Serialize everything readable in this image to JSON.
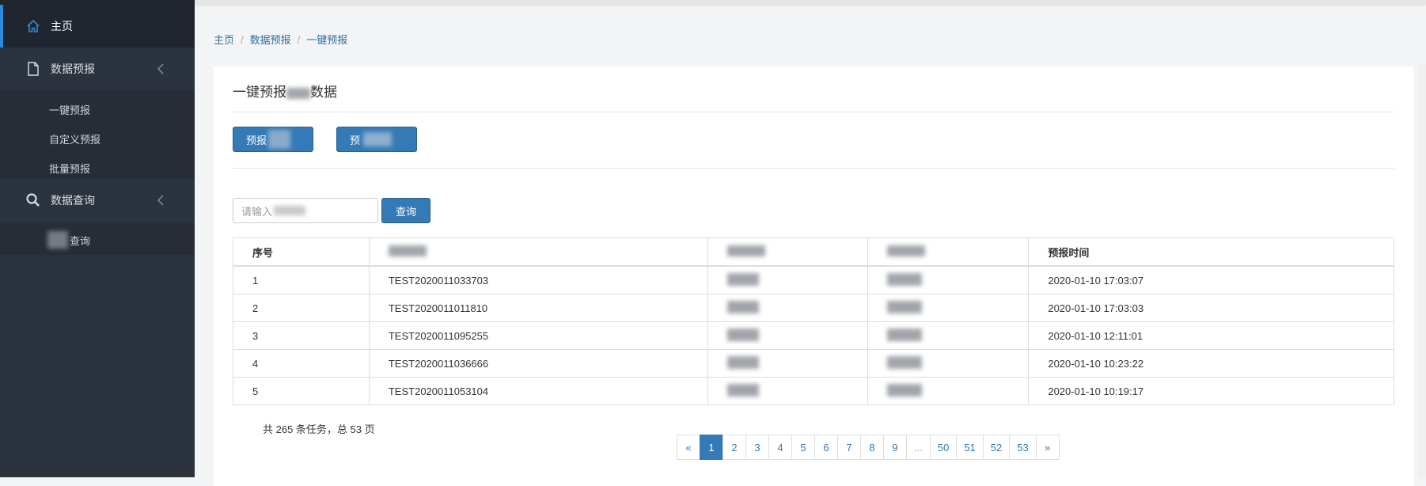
{
  "sidebar": {
    "home": "主页",
    "data_forecast": "数据预报",
    "sub_forecast": [
      "一键预报",
      "自定义预报",
      "批量预报"
    ],
    "data_query": "数据查询",
    "sub_query": "查询"
  },
  "breadcrumb": [
    "主页",
    "数据预报",
    "一键预报"
  ],
  "panel": {
    "title_prefix": "一键预报",
    "title_suffix": "数据",
    "btn1": "预报",
    "btn2": "预",
    "search_placeholder": "请输入",
    "query_button": "查询"
  },
  "table": {
    "headers": [
      "序号",
      "",
      "",
      "",
      "预报时间"
    ],
    "rows": [
      [
        "1",
        "TEST2020011033703",
        "",
        "",
        "2020-01-10 17:03:07"
      ],
      [
        "2",
        "TEST2020011011810",
        "",
        "",
        "2020-01-10 17:03:03"
      ],
      [
        "3",
        "TEST2020011095255",
        "",
        "",
        "2020-01-10 12:11:01"
      ],
      [
        "4",
        "TEST2020011036666",
        "",
        "",
        "2020-01-10 10:23:22"
      ],
      [
        "5",
        "TEST2020011053104",
        "",
        "",
        "2020-01-10 10:19:17"
      ]
    ]
  },
  "summary": "共 265 条任务，总 53 页",
  "pagination": [
    "«",
    "1",
    "2",
    "3",
    "4",
    "5",
    "6",
    "7",
    "8",
    "9",
    "...",
    "50",
    "51",
    "52",
    "53",
    "»"
  ],
  "colors": {
    "sidebar": "#2b333e",
    "accent": "#337ab7",
    "active_bar": "#2e8bd8"
  }
}
